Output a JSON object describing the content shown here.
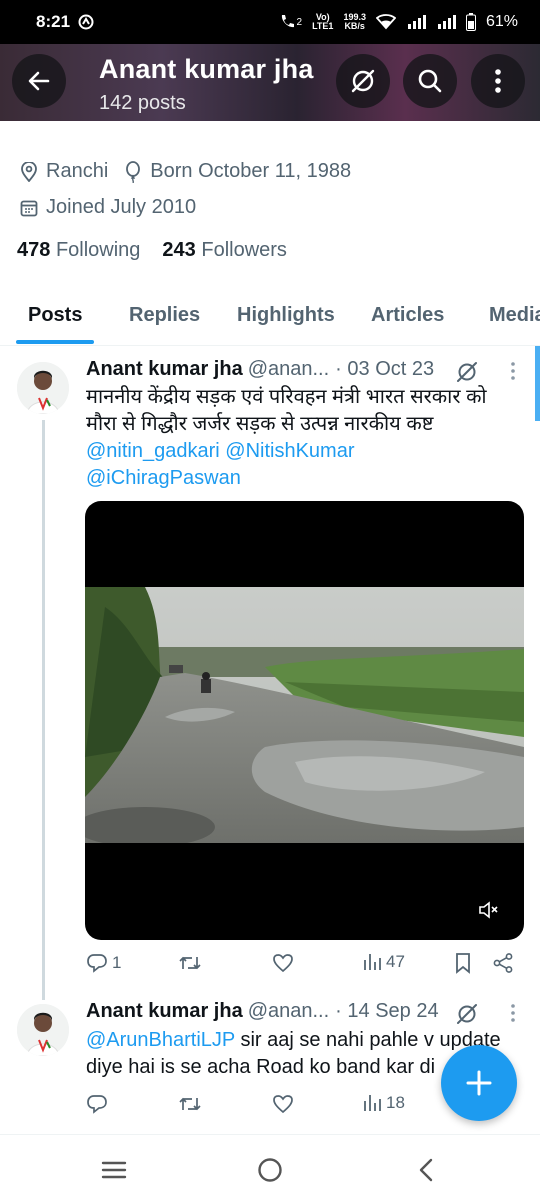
{
  "status_bar": {
    "time": "8:21",
    "network_top": "199.3",
    "network_bottom": "KB/s",
    "volte_top": "Vo)",
    "volte_bottom": "LTE1",
    "sim": "2",
    "battery": "61%"
  },
  "header": {
    "name": "Anant kumar jha",
    "posts": "142 posts",
    "back_icon": "arrow-left-icon",
    "grok_icon": "grok-icon",
    "search_icon": "search-icon",
    "more_icon": "more-vertical-icon"
  },
  "profile": {
    "location": "Ranchi",
    "born": "Born October 11, 1988",
    "joined": "Joined July 2010",
    "following_count": "478",
    "following_label": "Following",
    "followers_count": "243",
    "followers_label": "Followers"
  },
  "tabs": [
    {
      "label": "Posts",
      "active": true
    },
    {
      "label": "Replies",
      "active": false
    },
    {
      "label": "Highlights",
      "active": false
    },
    {
      "label": "Articles",
      "active": false
    },
    {
      "label": "Media",
      "active": false
    }
  ],
  "tweets": [
    {
      "name": "Anant kumar jha",
      "handle": "@anan...",
      "date": "· 03 Oct 23",
      "text": "माननीय केंद्रीय सड़क एवं परिवहन मंत्री भारत सरकार को मौरा से  गिद्धौर जर्जर सड़क से उत्पन्न नारकीय कष्ट",
      "mention1": "@nitin_gadkari",
      "mention2": "@NitishKumar",
      "mention3": "@iChiragPaswan",
      "reply_count": "1",
      "views_count": "47",
      "mute_icon": "volume-mute-icon"
    },
    {
      "name": "Anant kumar jha",
      "handle": "@anan...",
      "date": "· 14 Sep 24",
      "mention": "@ArunBhartiLJP",
      "text_rest": " sir aaj se nahi pahle v update diye hai is se acha Road ko band kar di",
      "views_count": "18"
    }
  ],
  "accent": "#1d9bf0"
}
